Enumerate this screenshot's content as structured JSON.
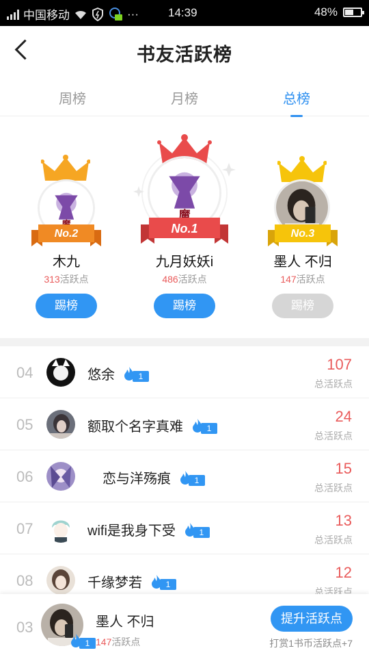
{
  "status_bar": {
    "carrier": "中国移动",
    "time": "14:39",
    "battery": "48%",
    "icons": [
      "signal-icon",
      "wifi-icon",
      "shield-icon",
      "notification-icon",
      "more-icon",
      "battery-icon"
    ]
  },
  "nav": {
    "title": "书友活跃榜"
  },
  "tabs": [
    {
      "label": "周榜",
      "active": false
    },
    {
      "label": "月榜",
      "active": false
    },
    {
      "label": "总榜",
      "active": true
    }
  ],
  "podium": {
    "first": {
      "badge": "No.1",
      "name": "九月妖妖i",
      "points": "486",
      "points_unit": "活跃点",
      "button": "踢榜",
      "button_enabled": true
    },
    "second": {
      "badge": "No.2",
      "name": "木九",
      "points": "313",
      "points_unit": "活跃点",
      "button": "踢榜",
      "button_enabled": true
    },
    "third": {
      "badge": "No.3",
      "name": "墨人 不归",
      "points": "147",
      "points_unit": "活跃点",
      "button": "踢榜",
      "button_enabled": false
    }
  },
  "list": {
    "score_label": "总活跃点",
    "rows": [
      {
        "rank": "04",
        "name": "悠余",
        "level": "1",
        "score": "107"
      },
      {
        "rank": "05",
        "name": "额取个名字真难",
        "level": "1",
        "score": "24"
      },
      {
        "rank": "06",
        "name": "恋与洋殇痕",
        "level": "1",
        "score": "15"
      },
      {
        "rank": "07",
        "name": "wifi是我身下受",
        "level": "1",
        "score": "13"
      },
      {
        "rank": "08",
        "name": "千缘梦若",
        "level": "1",
        "score": "12"
      }
    ]
  },
  "my_rank": {
    "rank": "03",
    "name": "墨人 不归",
    "level": "1",
    "points": "147",
    "points_unit": "活跃点",
    "button": "提升活跃点",
    "tip": "打赏1书币活跃点+7"
  },
  "colors": {
    "accent": "#3196f3",
    "score_red": "#e95b5b",
    "gold": "#f6a623",
    "orange": "#f08a24",
    "red": "#e94b4b"
  }
}
